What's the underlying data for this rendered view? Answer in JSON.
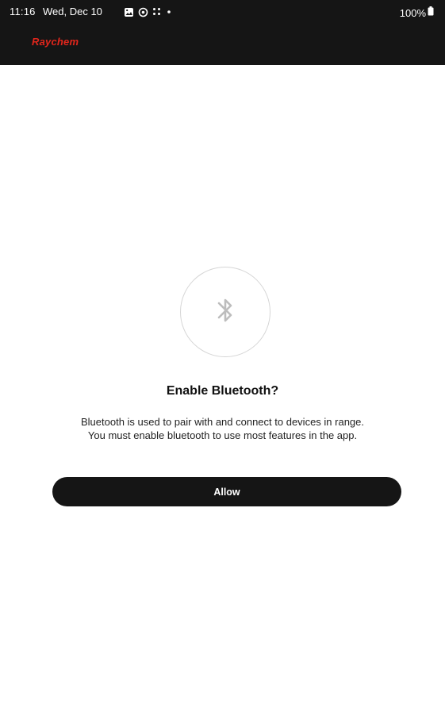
{
  "status_bar": {
    "time": "11:16",
    "date": "Wed, Dec 10",
    "battery": "100%"
  },
  "header": {
    "brand_name": "Raychem"
  },
  "dialog": {
    "icon": "bluetooth-icon",
    "title": "Enable Bluetooth?",
    "body_line1": "Bluetooth is used to pair with and connect to devices in range.",
    "body_line2": "You must enable bluetooth to use most features in the app.",
    "allow_label": "Allow"
  },
  "colors": {
    "header_background": "#151515",
    "brand_red": "#e1261c",
    "button_background": "#151515",
    "icon_gray": "#bdbdbd"
  }
}
